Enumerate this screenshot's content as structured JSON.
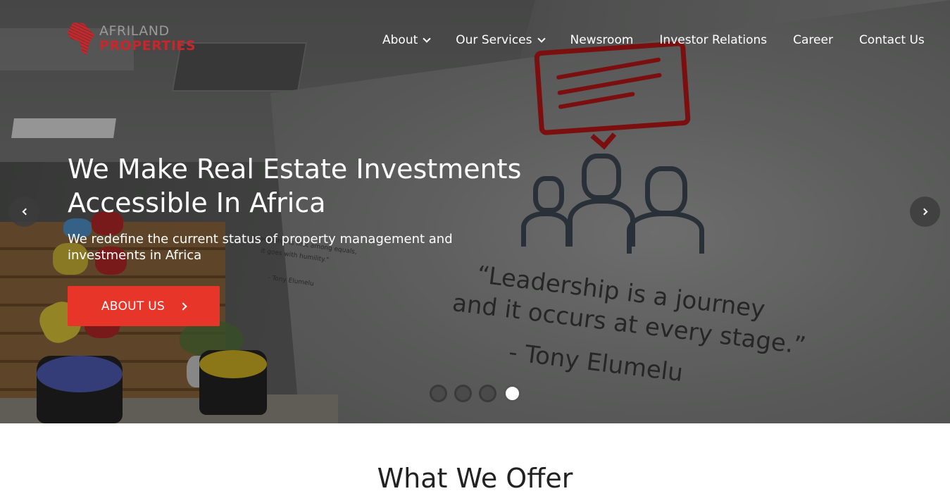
{
  "brand": {
    "name_top": "AFRILAND",
    "name_bottom": "PROPERTIES",
    "accent_color": "#c8262b",
    "grey_color": "#9a9a9a"
  },
  "nav": {
    "items": [
      {
        "label": "About",
        "has_dropdown": true
      },
      {
        "label": "Our Services",
        "has_dropdown": true
      },
      {
        "label": "Newsroom",
        "has_dropdown": false
      },
      {
        "label": "Investor Relations",
        "has_dropdown": false
      },
      {
        "label": "Career",
        "has_dropdown": false
      },
      {
        "label": "Contact Us",
        "has_dropdown": false
      }
    ]
  },
  "hero": {
    "headline_line1": "We Make Real Estate Investments",
    "headline_line2": "Accessible In Africa",
    "subline_line1": "We redefine the current status of property management and",
    "subline_line2": "investments in Africa",
    "cta_label": "ABOUT US",
    "cta_color": "#e8352a",
    "wall_quote_line1": "“Leadership is a journey",
    "wall_quote_line2": "and it occurs at every stage.”",
    "wall_quote_author": "- Tony Elumelu",
    "wall_small_line1": "Leadership is first among equals,",
    "wall_small_line2": "it goes with humility.\"",
    "wall_small_author": "- Tony Elumelu",
    "slider": {
      "slide_count": 4,
      "active_index": 3,
      "prev_icon": "chevron-left-icon",
      "next_icon": "chevron-right-icon"
    }
  },
  "section": {
    "title": "What We Offer"
  }
}
